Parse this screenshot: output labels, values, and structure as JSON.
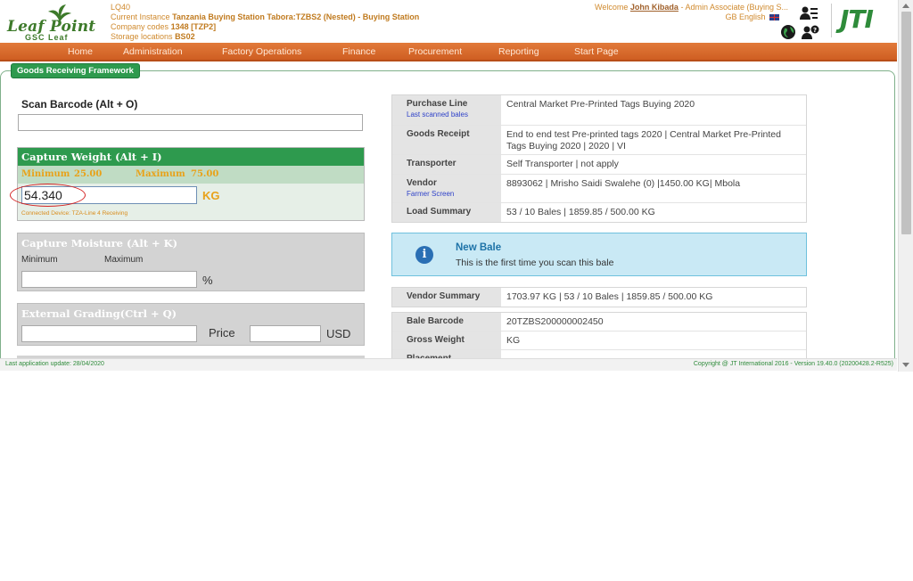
{
  "header": {
    "app_code": "LQ40",
    "instance_prefix": "Current Instance",
    "instance_name": "Tanzania Buying Station Tabora:TZBS2 (Nested) - Buying Station",
    "company_prefix": "Company codes",
    "company_codes": "1348 [TZP2]",
    "storage_prefix": "Storage locations",
    "storage_locations": "BS02",
    "welcome_prefix": "Welcome",
    "user_name": "John Kibada",
    "user_role": "- Admin Associate (Buying S...",
    "language": "GB English",
    "logo_text": "Leaf Point",
    "logo_sub": "GSC Leaf",
    "brand": "JTI"
  },
  "nav": {
    "items": [
      "Home",
      "Administration",
      "Factory Operations",
      "Finance",
      "Procurement",
      "Reporting",
      "Start Page"
    ]
  },
  "frame": {
    "title": "Goods Receiving Framework"
  },
  "scan": {
    "label": "Scan Barcode (Alt + O)",
    "value": ""
  },
  "weight": {
    "title": "Capture Weight (Alt + I)",
    "min_label": "Minimum",
    "min_value": "25.00",
    "max_label": "Maximum",
    "max_value": "75.00",
    "value": "54.340",
    "unit": "KG",
    "device": "Connected Device: TZA-Line 4 Receiving"
  },
  "moisture": {
    "title": "Capture Moisture (Alt + K)",
    "min_label": "Minimum",
    "max_label": "Maximum",
    "value": "",
    "unit": "%"
  },
  "grading": {
    "title": "External Grading(Ctrl + Q)",
    "value": "",
    "price_label": "Price",
    "price_value": "",
    "currency": "USD"
  },
  "purchase_info": [
    {
      "key": "Purchase Line",
      "sub": "Last scanned bales",
      "value": "Central Market Pre-Printed Tags Buying 2020"
    },
    {
      "key": "Goods Receipt",
      "sub": "",
      "value": "End to end test Pre-printed tags 2020 | Central Market Pre-Printed Tags Buying 2020 | 2020 | VI"
    },
    {
      "key": "Transporter",
      "sub": "",
      "value": "Self Transporter | not apply"
    },
    {
      "key": "Vendor",
      "sub": "Farmer Screen",
      "value": "8893062 | Mrisho Saidi Swalehe (0) |1450.00 KG| Mbola"
    },
    {
      "key": "Load Summary",
      "sub": "",
      "value": "53 / 10 Bales | 1859.85 / 500.00 KG"
    }
  ],
  "alert": {
    "title": "New Bale",
    "message": "This is the first time you scan this bale"
  },
  "vendor_summary": {
    "key": "Vendor Summary",
    "value": "1703.97 KG | 53 / 10 Bales | 1859.85 / 500.00 KG"
  },
  "bale_info": [
    {
      "key": "Bale Barcode",
      "value": "20TZBS200000002450"
    },
    {
      "key": "Gross Weight",
      "value": "KG"
    },
    {
      "key": "Placement",
      "value": ""
    }
  ],
  "footer": {
    "last_update": "Last application update: 28/04/2020",
    "copyright": "Copyright @ JT International 2016 - Version 19.40.0 (20200428.2-R525)"
  }
}
